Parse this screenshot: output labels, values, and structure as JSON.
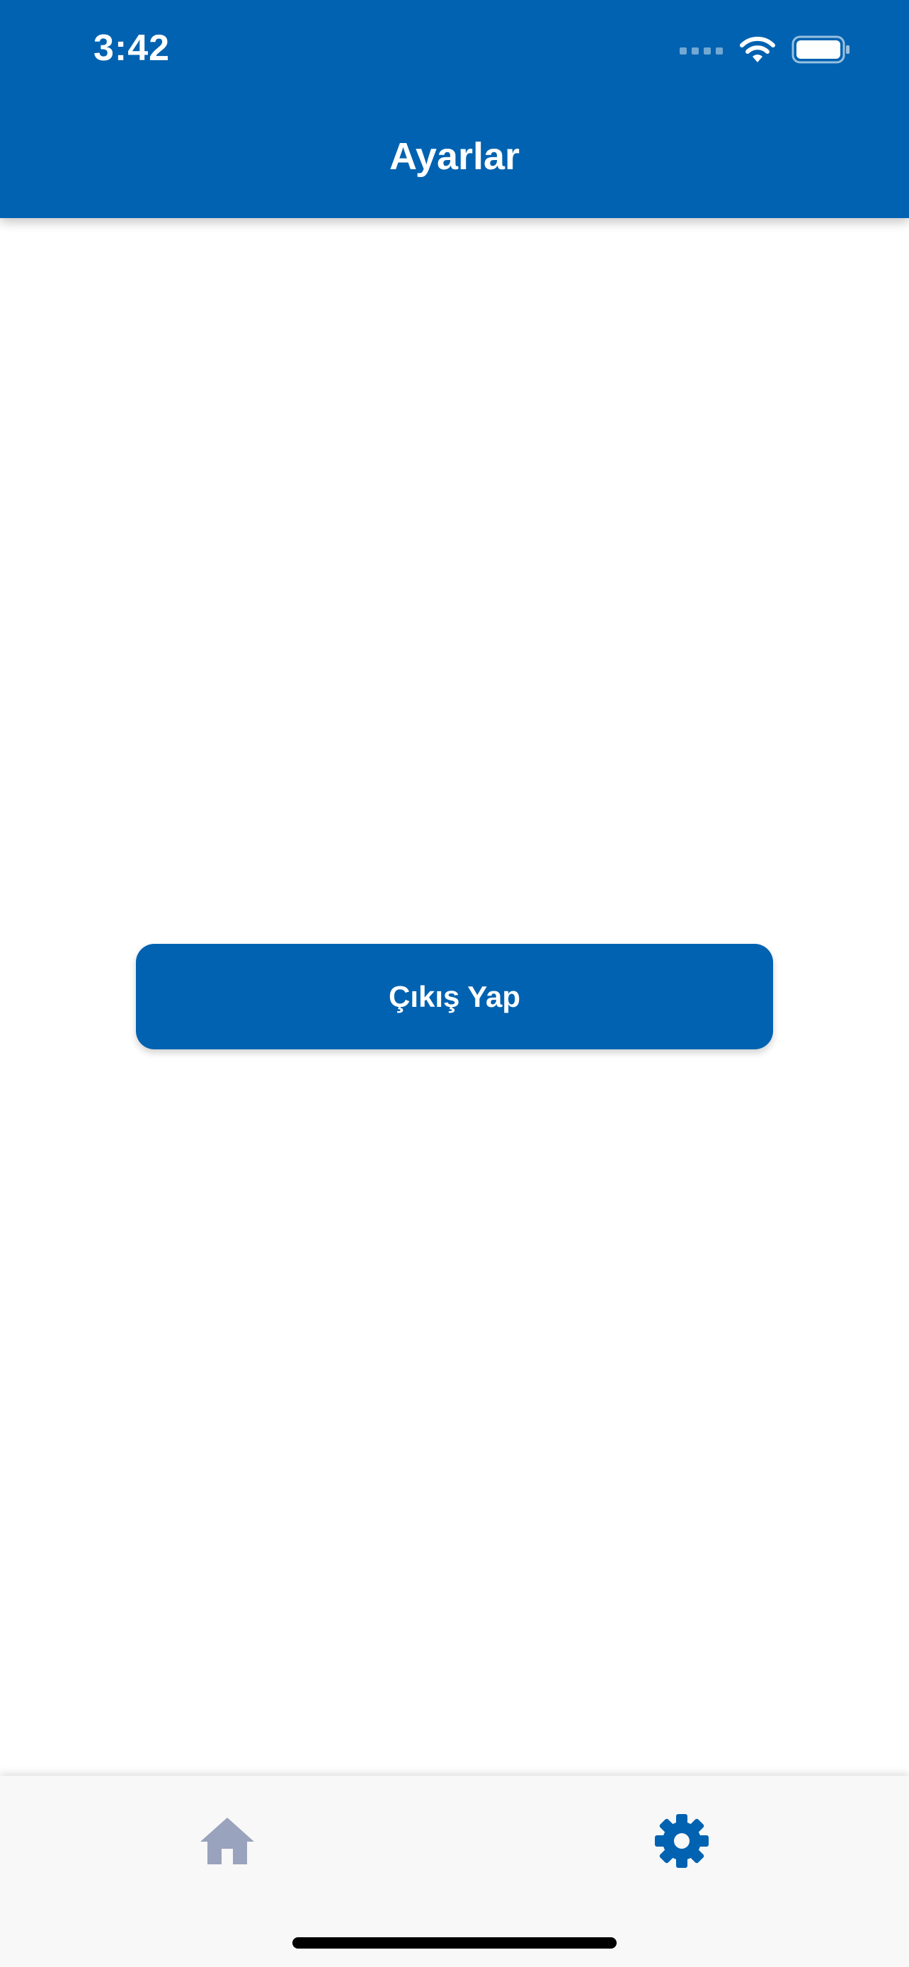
{
  "status_bar": {
    "time": "3:42",
    "icons": [
      "signal-icon",
      "wifi-icon",
      "battery-icon"
    ]
  },
  "header": {
    "title": "Ayarlar"
  },
  "main": {
    "logout_label": "Çıkış Yap"
  },
  "tab_bar": {
    "tabs": [
      {
        "icon": "home-icon",
        "active": false
      },
      {
        "icon": "gear-icon",
        "active": true
      }
    ]
  },
  "colors": {
    "primary": "#0062B0",
    "tab_inactive": "#9AA3BD",
    "tab_bar_bg": "#F8F8F8"
  }
}
